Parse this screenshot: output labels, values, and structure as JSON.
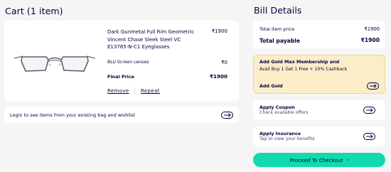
{
  "cart": {
    "heading": "Cart (1 item)",
    "item": {
      "title": "Dark Gunmetal Full Rim Geometric Vincent Chase Sleek Steel VC E13785-N-C1 Eyeglasses",
      "price": "₹1900",
      "lens_label": "BLU Screen Lenses",
      "lens_price": "₹0",
      "final_label": "Final Price",
      "final_price": "₹1900",
      "remove_label": "Remove",
      "repeat_label": "Repeat",
      "image_icon": "eyeglasses-image"
    },
    "login_prompt": "Login to see items from your existing bag and wishlist"
  },
  "bill": {
    "heading": "Bill Details",
    "total_item_label": "Total item price",
    "total_item_value": "₹1900",
    "total_payable_label": "Total payable",
    "total_payable_value": "₹1900"
  },
  "gold": {
    "title": "Add Gold Max Membership and",
    "subtitle": "Avail Buy 1 Get 1 Free + 10% Cashback",
    "action_label": "Add Gold"
  },
  "coupon": {
    "title": "Apply Coupon",
    "subtitle": "Check available offers"
  },
  "insurance": {
    "title": "Apply Insurance",
    "subtitle": "Tap to view your benefits"
  },
  "checkout": {
    "label": "Proceed To Checkout",
    "chevron": "›"
  },
  "colors": {
    "background": "#f5f5f5",
    "text": "#000042",
    "gold_bg": "#fbedc8",
    "checkout_bg": "#11daac"
  }
}
